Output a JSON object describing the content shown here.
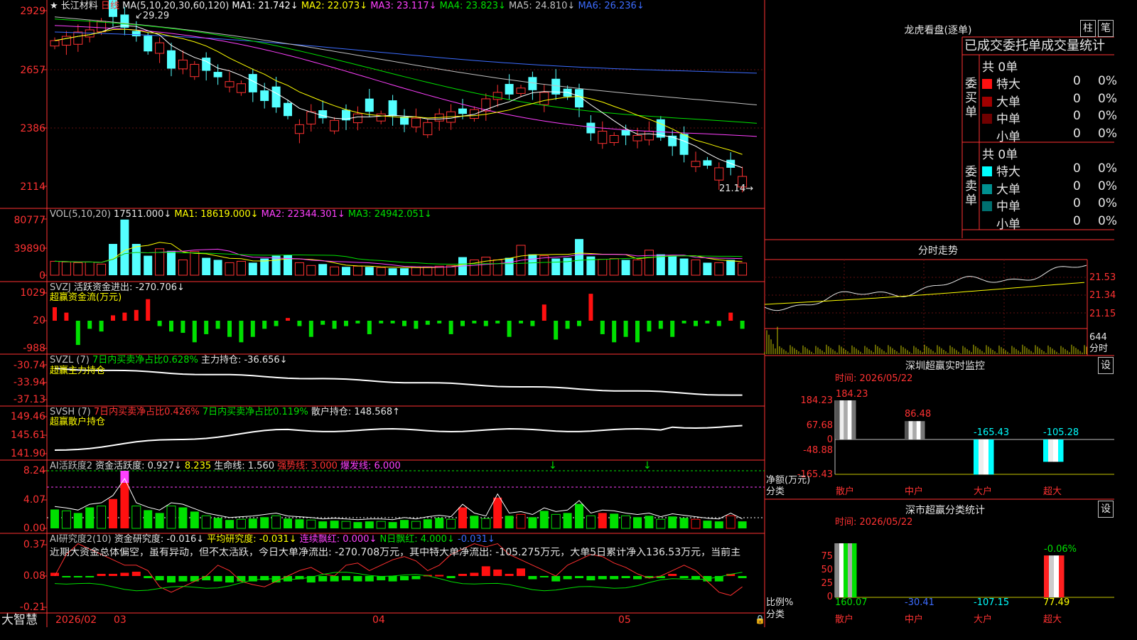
{
  "stock": {
    "title_prefix": "★",
    "name": "长江材料",
    "period": "日线",
    "ma_text": "MA(5,10,20,30,60,120)",
    "ma": [
      {
        "label": "MA1: 21.742↓",
        "color": "#ffffff"
      },
      {
        "label": "MA2: 22.073↓",
        "color": "#ffff00"
      },
      {
        "label": "MA3: 23.117↓",
        "color": "#ff40ff"
      },
      {
        "label": "MA4: 23.823↓",
        "color": "#00e000"
      },
      {
        "label": "MA5: 24.810↓",
        "color": "#c0c0c0"
      },
      {
        "label": "MA6: 26.236↓",
        "color": "#3c6cff"
      }
    ],
    "high_mark": "29.29",
    "low_mark": "21.14"
  },
  "price_axis": [
    "2929",
    "2657",
    "2386",
    "2114"
  ],
  "vol": {
    "header": "VOL(5,10,20)",
    "value": "17511.000↓",
    "ma1": "MA1: 18619.000↓",
    "ma2": "MA2: 22344.301↓",
    "ma3": "MA3: 24942.051↓",
    "axis": [
      "80777",
      "39890",
      "0"
    ]
  },
  "svzj": {
    "header": "SVZJ",
    "text": "活跃资金进出: -270.706↓",
    "sub": "超赢资金流(万元)",
    "axis": [
      "1029",
      "20",
      "-988"
    ]
  },
  "svzl": {
    "header": "SVZL (7)",
    "t1": "7日内买卖净占比0.628%",
    "t2": "主力持仓: -36.656↓",
    "sub": "超赢主力持仓",
    "axis": [
      "-30.74",
      "-33.94",
      "-37.13"
    ]
  },
  "svsh": {
    "header": "SVSH (7)",
    "t1": "7日内买卖净占比0.426%",
    "t2": "7日内买卖净占比0.119%",
    "t3": "散户持仓: 148.568↑",
    "sub": "超赢散户持仓",
    "axis": [
      "149.46",
      "145.61",
      "141.90"
    ]
  },
  "ai1": {
    "header": "AI活跃度2",
    "t1": "资金活跃度: 0.927↓",
    "t2": "8.235",
    "t3": "生命线: 1.560",
    "t4": "强势线: 3.000",
    "t5": "爆发线: 6.000",
    "axis": [
      "8.24",
      "4.07",
      "0.00"
    ]
  },
  "ai2": {
    "header": "AI研究度2(10)",
    "t1": "资金研究度: -0.016↓",
    "t2": "平均研究度: -0.031↓",
    "t3": "连续飘红: 0.000↓",
    "t4": "N日飘红: 4.000↓",
    "t5": "-0.031↓",
    "comment": "近期大资金总体偏空，虽有异动，但不太活跃，今日大单净流出: -270.708万元，其中特大单净流出: -105.275万元，大单5日累计净入136.53万元，当前主",
    "axis": [
      "0.37",
      "0.08",
      "-0.21"
    ]
  },
  "dates": [
    "2026/02",
    "03",
    "04",
    "05"
  ],
  "brand": "大智慧",
  "longhu": {
    "title": "龙虎看盘(逐单)",
    "btn1": "柱",
    "btn2": "笔",
    "subtitle": "已成交委托单成交量统计",
    "buy_label": "委买单",
    "sell_label": "委卖单",
    "buy_total": "共 0单",
    "sell_total": "共 0单",
    "buy": [
      {
        "name": "特大",
        "n": "0",
        "p": "0%",
        "color": "#ff1010"
      },
      {
        "name": "大单",
        "n": "0",
        "p": "0%",
        "color": "#a00000"
      },
      {
        "name": "中单",
        "n": "0",
        "p": "0%",
        "color": "#700000"
      },
      {
        "name": "小单",
        "n": "0",
        "p": "0%",
        "color": "#000000"
      }
    ],
    "sell": [
      {
        "name": "特大",
        "n": "0",
        "p": "0%",
        "color": "#00ffff"
      },
      {
        "name": "大单",
        "n": "0",
        "p": "0%",
        "color": "#009090"
      },
      {
        "name": "中单",
        "n": "0",
        "p": "0%",
        "color": "#007070"
      },
      {
        "name": "小单",
        "n": "0",
        "p": "0%",
        "color": "#000000"
      }
    ]
  },
  "intraday": {
    "title": "分时走势",
    "axis": [
      "21.53",
      "21.34",
      "21.15"
    ],
    "vol_axis": "644",
    "vol_label": "分时"
  },
  "monitor": {
    "title": "深圳超赢实时监控",
    "btn": "设",
    "time": "时间: 2026/05/22",
    "axis": [
      "184.23",
      "67.68",
      "0",
      "-48.88",
      "-165.43"
    ],
    "ylabel": "净额(万元)",
    "xlabel": "分类",
    "bars": [
      {
        "cat": "散户",
        "value": 184.23,
        "label": "184.23"
      },
      {
        "cat": "中户",
        "value": 86.48,
        "label": "86.48"
      },
      {
        "cat": "大户",
        "value": -165.43,
        "label": "-165.43"
      },
      {
        "cat": "超大",
        "value": -105.28,
        "label": "-105.28"
      }
    ]
  },
  "category": {
    "title": "深市超赢分类统计",
    "btn": "设",
    "time": "时间: 2026/05/22",
    "axis": [
      "75",
      "50",
      "25",
      "0"
    ],
    "ylabel": "比例%",
    "xlabel": "分类",
    "cats": [
      {
        "cat": "散户",
        "value": "160.07",
        "color": "#00e000"
      },
      {
        "cat": "中户",
        "value": "-30.41",
        "color": "#3c6cff"
      },
      {
        "cat": "大户",
        "value": "-107.15",
        "color": "#00ffff"
      },
      {
        "cat": "超大",
        "value": "77.49",
        "color": "#ffff00"
      }
    ],
    "top_label": "-0.06%"
  }
}
